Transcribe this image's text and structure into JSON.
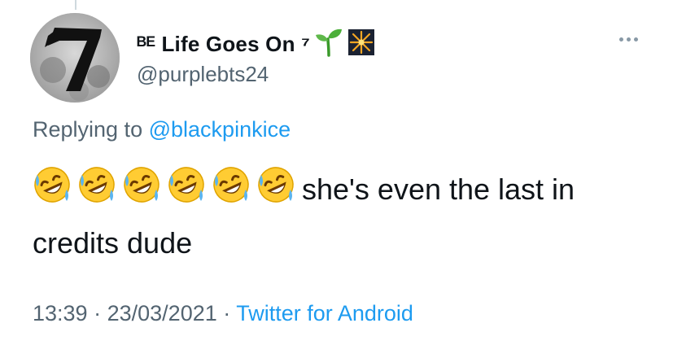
{
  "tweet": {
    "display_name": "ᴮᴱ Life Goes On ⁷",
    "handle": "@purplebts24",
    "replying_prefix": "Replying to",
    "replying_handle": "@blackpinkice",
    "emoji_count": 6,
    "emoji_name": "rolling-on-floor-laughing",
    "text_line_1": "she's even the last in",
    "text_line_2": "credits dude",
    "time": "13:39",
    "separator": "·",
    "date": "23/03/2021",
    "source": "Twitter for Android"
  },
  "icons": {
    "seedling": "seedling-icon",
    "fireworks": "fireworks-icon",
    "more": "more-icon"
  },
  "colors": {
    "link": "#1d9bf0",
    "secondary_text": "#536471",
    "primary_text": "#0f1419"
  }
}
